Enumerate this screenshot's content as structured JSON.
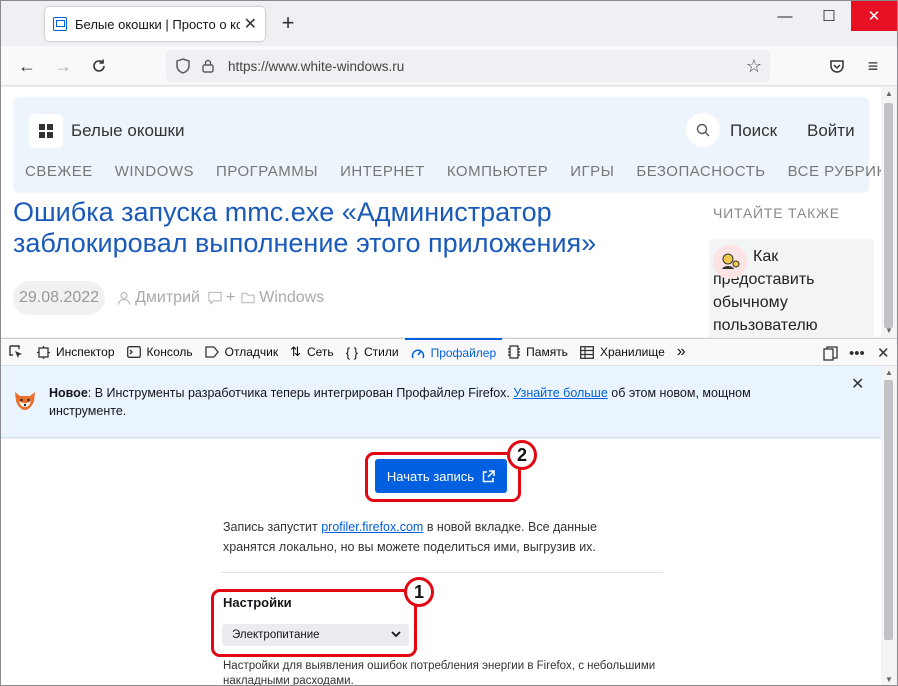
{
  "browser": {
    "tab_title": "Белые окошки | Просто о комп",
    "tab_close": "✕",
    "new_tab": "+",
    "url": "https://www.white-windows.ru",
    "window_controls": {
      "minimize": "—",
      "maximize": "☐",
      "close": "✕"
    }
  },
  "site": {
    "name": "Белые окошки",
    "search_label": "Поиск",
    "login_label": "Войти",
    "menu": [
      "СВЕЖЕЕ",
      "WINDOWS",
      "ПРОГРАММЫ",
      "ИНТЕРНЕТ",
      "КОМПЬЮТЕР",
      "ИГРЫ",
      "БЕЗОПАСНОСТЬ",
      "ВСЕ РУБРИКИ"
    ],
    "article_title": "Ошибка запуска mmc.exe «Администратор заблокировал выполнение этого приложения»",
    "date": "29.08.2022",
    "author": "Дмитрий",
    "comments_plus": "+",
    "category": "Windows",
    "sidebar_heading": "ЧИТАЙТЕ ТАКЖЕ",
    "sidebar_item": "Как предоставить обычному пользователю"
  },
  "devtools": {
    "tabs": [
      "Инспектор",
      "Консоль",
      "Отладчик",
      "Сеть",
      "Стили",
      "Профайлер",
      "Память",
      "Хранилище"
    ],
    "active_tab": "Профайлер",
    "more": "»",
    "notice": {
      "bold": "Новое",
      "text1": ": В Инструменты разработчика теперь интегрирован Профайлер Firefox. ",
      "link": "Узнайте больше",
      "text2": " об этом новом, мощном инструменте."
    },
    "profiler": {
      "start_button": "Начать запись",
      "desc_pre": "Запись запустит ",
      "desc_link": "profiler.firefox.com",
      "desc_post": " в новой вкладке. Все данные хранятся локально, но вы можете поделиться ими, выгрузив их.",
      "settings_heading": "Настройки",
      "preset_selected": "Электропитание",
      "preset_hint": "Настройки для выявления ошибок потребления энергии в Firefox, с небольшими накладными расходами."
    }
  },
  "annotations": {
    "badge_1": "1",
    "badge_2": "2",
    "color": "#e30613"
  },
  "colors": {
    "accent": "#0060df",
    "headline": "#1a5ab8",
    "close_button": "#e81123"
  }
}
